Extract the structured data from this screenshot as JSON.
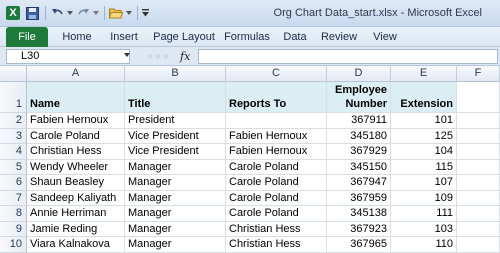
{
  "window": {
    "title": "Org Chart Data_start.xlsx - Microsoft Excel",
    "app_letter": "X"
  },
  "ribbon": {
    "tabs": [
      "File",
      "Home",
      "Insert",
      "Page Layout",
      "Formulas",
      "Data",
      "Review",
      "View"
    ]
  },
  "formula_bar": {
    "name_box": "L30",
    "fx_label": "fx",
    "value": ""
  },
  "columns": [
    "A",
    "B",
    "C",
    "D",
    "E",
    "F"
  ],
  "header_row": {
    "name": "Name",
    "title": "Title",
    "reports_to": "Reports To",
    "employee_line1": "Employee",
    "employee_line2": "Number",
    "extension": "Extension"
  },
  "rows": [
    {
      "num": "2",
      "name": "Fabien Hernoux",
      "title": "President",
      "reports_to": "",
      "emp": "367911",
      "ext": "101"
    },
    {
      "num": "3",
      "name": "Carole Poland",
      "title": "Vice President",
      "reports_to": "Fabien Hernoux",
      "emp": "345180",
      "ext": "125"
    },
    {
      "num": "4",
      "name": "Christian Hess",
      "title": "Vice President",
      "reports_to": "Fabien Hernoux",
      "emp": "367929",
      "ext": "104"
    },
    {
      "num": "5",
      "name": "Wendy Wheeler",
      "title": "Manager",
      "reports_to": "Carole Poland",
      "emp": "345150",
      "ext": "115"
    },
    {
      "num": "6",
      "name": "Shaun Beasley",
      "title": "Manager",
      "reports_to": "Carole Poland",
      "emp": "367947",
      "ext": "107"
    },
    {
      "num": "7",
      "name": "Sandeep Kaliyath",
      "title": "Manager",
      "reports_to": "Carole Poland",
      "emp": "367959",
      "ext": "109"
    },
    {
      "num": "8",
      "name": "Annie Herriman",
      "title": "Manager",
      "reports_to": "Carole Poland",
      "emp": "345138",
      "ext": "111"
    },
    {
      "num": "9",
      "name": "Jamie Reding",
      "title": "Manager",
      "reports_to": "Christian Hess",
      "emp": "367923",
      "ext": "103"
    },
    {
      "num": "10",
      "name": "Viara Kalnakova",
      "title": "Manager",
      "reports_to": "Christian Hess",
      "emp": "367965",
      "ext": "110"
    }
  ],
  "header_row_num": "1",
  "colors": {
    "file_tab": "#1e7b3c",
    "header_fill": "#dbeef4"
  }
}
